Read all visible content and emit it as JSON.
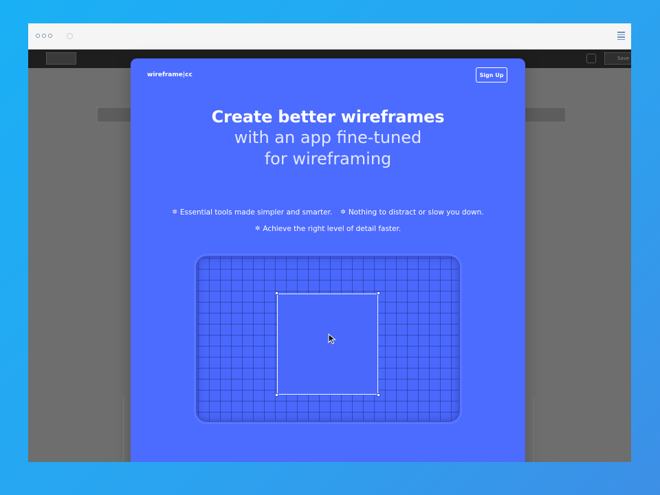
{
  "browser": {
    "menu_icon": "hamburger-menu-icon",
    "loading_icon": "loading-spinner-icon"
  },
  "app_toolbar": {
    "partial_label": "Save"
  },
  "modal": {
    "brand": "wireframe|cc",
    "signup_label": "Sign Up",
    "headline": "Create better wireframes",
    "subheadline_line1": "with an app fine-tuned",
    "subheadline_line2": "for wireframing",
    "features": [
      "Essential tools made simpler and smarter.",
      "Nothing to distract or slow you down.",
      "Achieve the right level of detail faster."
    ],
    "feature_icon": "sparkle-icon"
  },
  "colors": {
    "background": "#1ab0f5",
    "modal": "#4c6bff",
    "overlay": "#6e6e6e"
  }
}
